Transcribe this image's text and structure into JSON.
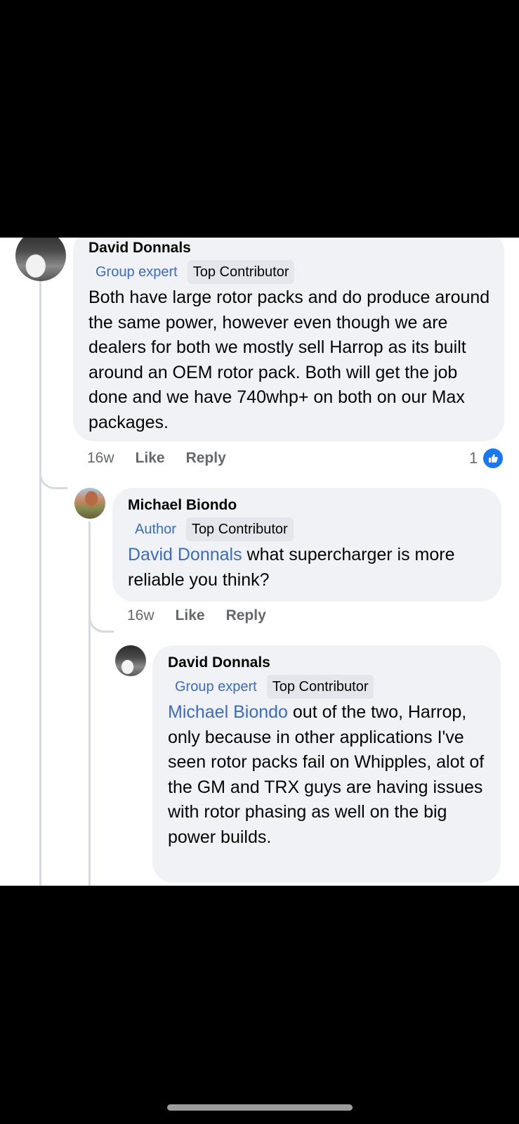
{
  "comments": [
    {
      "author": "David Donnals",
      "role_badge": "Group expert",
      "top_badge": "Top Contributor",
      "text": "Both have large rotor packs and do produce around the same power, however even though we are dealers for both we mostly sell Harrop as its built around an OEM rotor pack. Both will get the job done and we have 740whp+ on both on our Max packages.",
      "time": "16w",
      "like_label": "Like",
      "reply_label": "Reply",
      "reaction_count": "1"
    },
    {
      "author": "Michael Biondo",
      "role_badge": "Author",
      "top_badge": "Top Contributor",
      "mention": "David Donnals",
      "text": " what supercharger is more reliable you think?",
      "time": "16w",
      "like_label": "Like",
      "reply_label": "Reply"
    },
    {
      "author": "David Donnals",
      "role_badge": "Group expert",
      "top_badge": "Top Contributor",
      "mention": "Michael Biondo",
      "text": " out of the two, Harrop, only because in other applications I've seen rotor packs fail on Whipples, alot of the GM and TRX guys are having issues with rotor phasing as well on the big power builds."
    }
  ],
  "colors": {
    "bubble": "#f0f2f5",
    "mention": "#3b6bc4",
    "like_blue": "#1877f2"
  }
}
